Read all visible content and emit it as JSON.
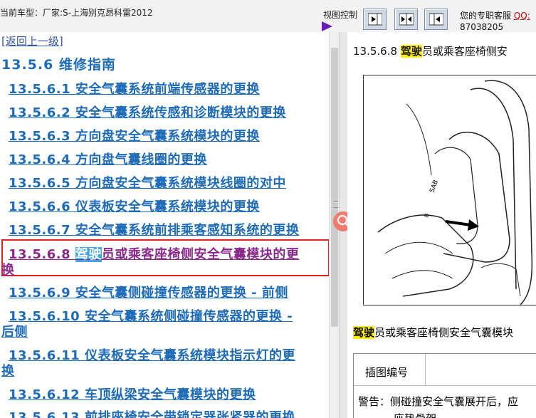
{
  "header": {
    "vehicle": "当前车型：厂家:S-上海别克昂科雷2012",
    "view_control": "视图控制",
    "support_label": "您的专职客服",
    "support_qq": "QQ:",
    "support_number": "87038205"
  },
  "nav": {
    "back": "[返回上一级]",
    "section": "13.5.6 维修指南",
    "items": [
      {
        "num": "13.5.6.1",
        "text": "安全气囊系统前端传感器的更换"
      },
      {
        "num": "13.5.6.2",
        "text": "安全气囊系统传感和诊断模块的更换"
      },
      {
        "num": "13.5.6.3",
        "text": "方向盘安全气囊系统模块的更换"
      },
      {
        "num": "13.5.6.4",
        "text": "方向盘气囊线圈的更换"
      },
      {
        "num": "13.5.6.5",
        "text": "方向盘安全气囊系统模块线圈的对中"
      },
      {
        "num": "13.5.6.6",
        "text": "仪表板安全气囊系统模块的更换"
      },
      {
        "num": "13.5.6.7",
        "text": "安全气囊系统前排乘客感知系统的更换"
      },
      {
        "num": "13.5.6.8",
        "hl": "驾驶",
        "text": "员或乘客座椅侧安全气囊模块的更",
        "text2": "换"
      },
      {
        "num": "13.5.6.9",
        "text": "安全气囊侧碰撞传感器的更换 - 前侧"
      },
      {
        "num": "13.5.6.10",
        "text": "安全气囊系统侧碰撞传感器的更换 -",
        "text2": "后侧"
      },
      {
        "num": "13.5.6.11",
        "text": "仪表板安全气囊系统模块指示灯的更",
        "text2": "换"
      },
      {
        "num": "13.5.6.12",
        "text": "车顶纵梁安全气囊模块的更换"
      },
      {
        "num": "13.5.6.13",
        "text": "前排座椅安全带锁定器张紧器的更换"
      }
    ]
  },
  "content": {
    "title_num": "13.5.6.8",
    "title_hl": "驾驶",
    "title_rest": "员或乘客座椅侧安",
    "caption_hl": "驾驶",
    "caption_rest": "员或乘客座椅侧安全气囊模块",
    "table_header": "插图编号",
    "warning": "警告：侧碰撞安全气囊展开后，应",
    "warning_cont": "座垫骨架"
  },
  "colors": {
    "link": "#1e6bb8",
    "highlight_border": "#dd2222",
    "search_highlight": "#ffee00"
  }
}
